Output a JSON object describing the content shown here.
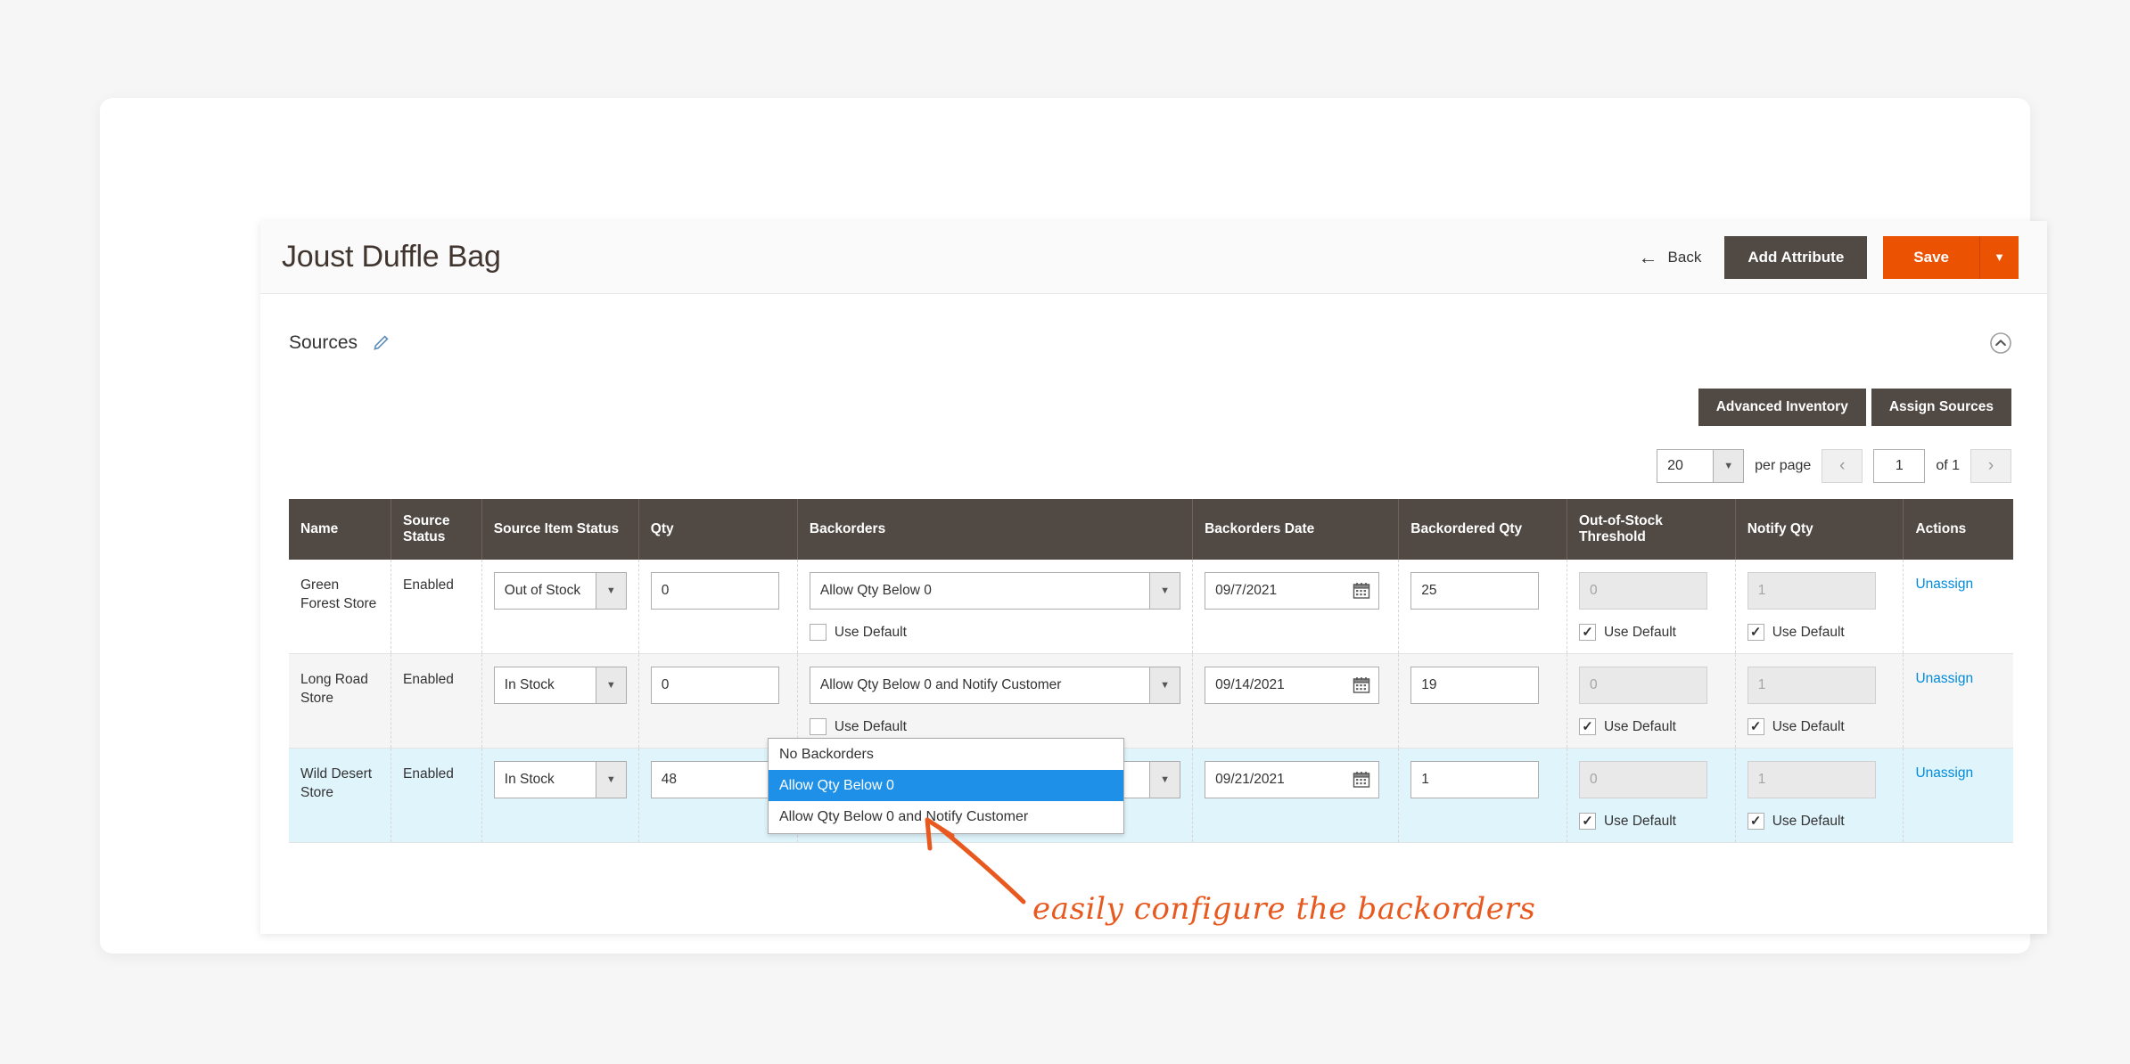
{
  "header": {
    "title": "Joust Duffle Bag",
    "back_label": "Back",
    "back_icon": "arrow-left-icon",
    "add_attribute_label": "Add Attribute",
    "save_label": "Save",
    "save_caret_icon": "caret-down-icon",
    "primary_color": "#eb5202",
    "dark_color": "#514943"
  },
  "section": {
    "title": "Sources",
    "edit_icon": "pencil-icon",
    "collapse_icon": "chevron-up-circle-icon"
  },
  "toolbar": {
    "advanced_inventory_label": "Advanced Inventory",
    "assign_sources_label": "Assign Sources"
  },
  "pager": {
    "per_page_value": "20",
    "per_page_label": "per page",
    "prev_icon": "chevron-left-icon",
    "next_icon": "chevron-right-icon",
    "current_page": "1",
    "total_pages_label": "of 1",
    "caret_icon": "caret-down-icon"
  },
  "grid": {
    "columns": [
      "Name",
      "Source Status",
      "Source Item Status",
      "Qty",
      "Backorders",
      "Backorders Date",
      "Backordered Qty",
      "Out-of-Stock Threshold",
      "Notify Qty",
      "Actions"
    ],
    "use_default_label": "Use Default",
    "unassign_label": "Unassign",
    "calendar_icon": "calendar-icon",
    "rows": [
      {
        "name": "Green Forest Store",
        "source_status": "Enabled",
        "source_item_status": "Out of Stock",
        "qty": "0",
        "backorders": "Allow Qty Below 0",
        "backorders_use_default": false,
        "backorders_date": "09/7/2021",
        "backordered_qty": "25",
        "oos_threshold": "0",
        "oos_use_default": true,
        "notify_qty": "1",
        "notify_use_default": true,
        "action": "Unassign"
      },
      {
        "name": "Long Road Store",
        "source_status": "Enabled",
        "source_item_status": "In Stock",
        "qty": "0",
        "backorders": "Allow Qty Below 0 and Notify Customer",
        "backorders_use_default": false,
        "backorders_date": "09/14/2021",
        "backordered_qty": "19",
        "oos_threshold": "0",
        "oos_use_default": true,
        "notify_qty": "1",
        "notify_use_default": true,
        "action": "Unassign"
      },
      {
        "name": "Wild Desert Store",
        "source_status": "Enabled",
        "source_item_status": "In Stock",
        "qty": "48",
        "backorders": "Allow Qty Below 0",
        "backorders_use_default": null,
        "backorders_date": "09/21/2021",
        "backordered_qty": "1",
        "oos_threshold": "0",
        "oos_use_default": true,
        "notify_qty": "1",
        "notify_use_default": true,
        "action": "Unassign"
      }
    ]
  },
  "dropdown": {
    "open": true,
    "options": [
      "No Backorders",
      "Allow Qty Below 0",
      "Allow Qty Below 0 and Notify Customer"
    ],
    "selected_index": 1,
    "highlight_color": "#1e90e8"
  },
  "annotation": {
    "text": "easily configure the backorders",
    "color": "#e8591f",
    "arrow_icon": "curved-arrow-up-icon"
  }
}
